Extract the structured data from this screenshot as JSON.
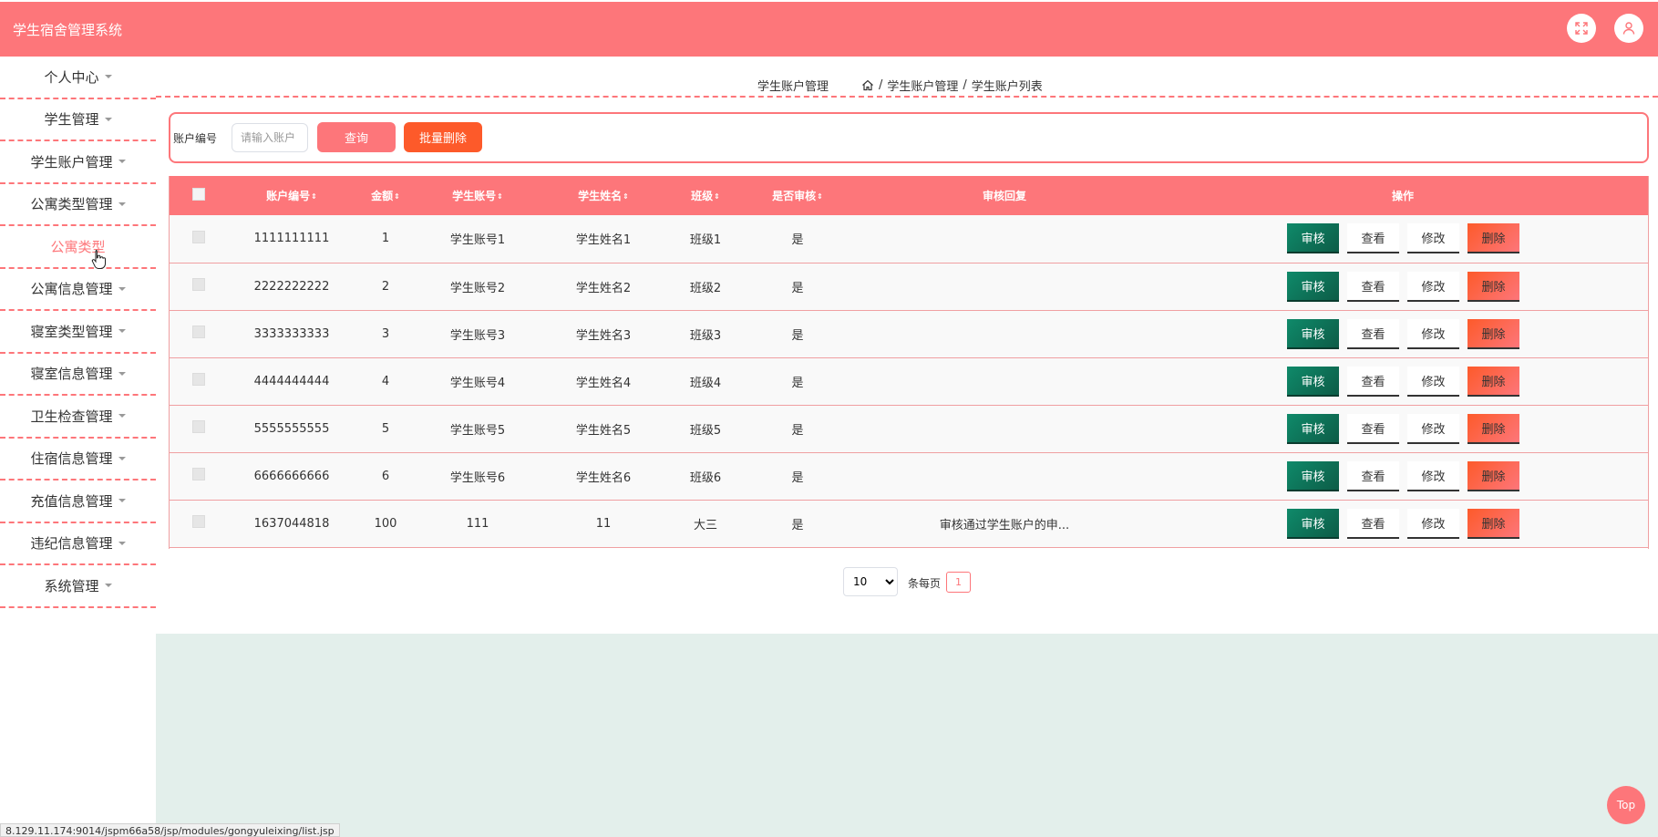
{
  "header": {
    "title": "学生宿舍管理系统",
    "fullscreen_icon": "fullscreen-icon",
    "user_icon": "user-icon"
  },
  "sidebar": {
    "items": [
      {
        "label": "个人中心",
        "caret": true
      },
      {
        "label": "学生管理",
        "caret": true
      },
      {
        "label": "学生账户管理",
        "caret": true
      },
      {
        "label": "公寓类型管理",
        "caret": true
      },
      {
        "label": "公寓类型",
        "caret": false,
        "active": true
      },
      {
        "label": "公寓信息管理",
        "caret": true
      },
      {
        "label": "寝室类型管理",
        "caret": true
      },
      {
        "label": "寝室信息管理",
        "caret": true
      },
      {
        "label": "卫生检查管理",
        "caret": true
      },
      {
        "label": "住宿信息管理",
        "caret": true
      },
      {
        "label": "充值信息管理",
        "caret": true
      },
      {
        "label": "违纪信息管理",
        "caret": true
      },
      {
        "label": "系统管理",
        "caret": true
      }
    ]
  },
  "breadcrumb": {
    "title": "学生账户管理",
    "home_icon": "home-icon",
    "sep1": "/",
    "item1": "学生账户管理",
    "sep2": "/",
    "item2": "学生账户列表"
  },
  "search": {
    "label": "账户编号",
    "placeholder": "请输入账户",
    "query_button": "查询",
    "bulk_delete_button": "批量删除"
  },
  "table": {
    "headers": [
      "账户编号",
      "金额",
      "学生账号",
      "学生姓名",
      "班级",
      "是否审核",
      "审核回复",
      "操作"
    ],
    "sortable": [
      true,
      true,
      true,
      true,
      true,
      true,
      false,
      false
    ],
    "rows": [
      {
        "account_no": "1111111111",
        "amount": "1",
        "student_account": "学生账号1",
        "student_name": "学生姓名1",
        "class": "班级1",
        "reviewed": "是",
        "reply": ""
      },
      {
        "account_no": "2222222222",
        "amount": "2",
        "student_account": "学生账号2",
        "student_name": "学生姓名2",
        "class": "班级2",
        "reviewed": "是",
        "reply": ""
      },
      {
        "account_no": "3333333333",
        "amount": "3",
        "student_account": "学生账号3",
        "student_name": "学生姓名3",
        "class": "班级3",
        "reviewed": "是",
        "reply": ""
      },
      {
        "account_no": "4444444444",
        "amount": "4",
        "student_account": "学生账号4",
        "student_name": "学生姓名4",
        "class": "班级4",
        "reviewed": "是",
        "reply": ""
      },
      {
        "account_no": "5555555555",
        "amount": "5",
        "student_account": "学生账号5",
        "student_name": "学生姓名5",
        "class": "班级5",
        "reviewed": "是",
        "reply": ""
      },
      {
        "account_no": "6666666666",
        "amount": "6",
        "student_account": "学生账号6",
        "student_name": "学生姓名6",
        "class": "班级6",
        "reviewed": "是",
        "reply": ""
      },
      {
        "account_no": "1637044818",
        "amount": "100",
        "student_account": "111",
        "student_name": "11",
        "class": "大三",
        "reviewed": "是",
        "reply": "审核通过学生账户的申..."
      }
    ],
    "actions": {
      "review": "审核",
      "view": "查看",
      "edit": "修改",
      "delete": "删除"
    }
  },
  "pagination": {
    "page_size": "10",
    "page_size_options": [
      "10"
    ],
    "per_page_label": "条每页",
    "current_page": "1"
  },
  "status_bar": {
    "url": "8.129.11.174:9014/jspm66a58/jsp/modules/gongyuleixing/list.jsp"
  },
  "top_button": "Top",
  "colors": {
    "primary": "#fd767a",
    "danger": "#fd5a2a",
    "review": "#0f8a6a",
    "panel_bg": "#e3efeb"
  }
}
